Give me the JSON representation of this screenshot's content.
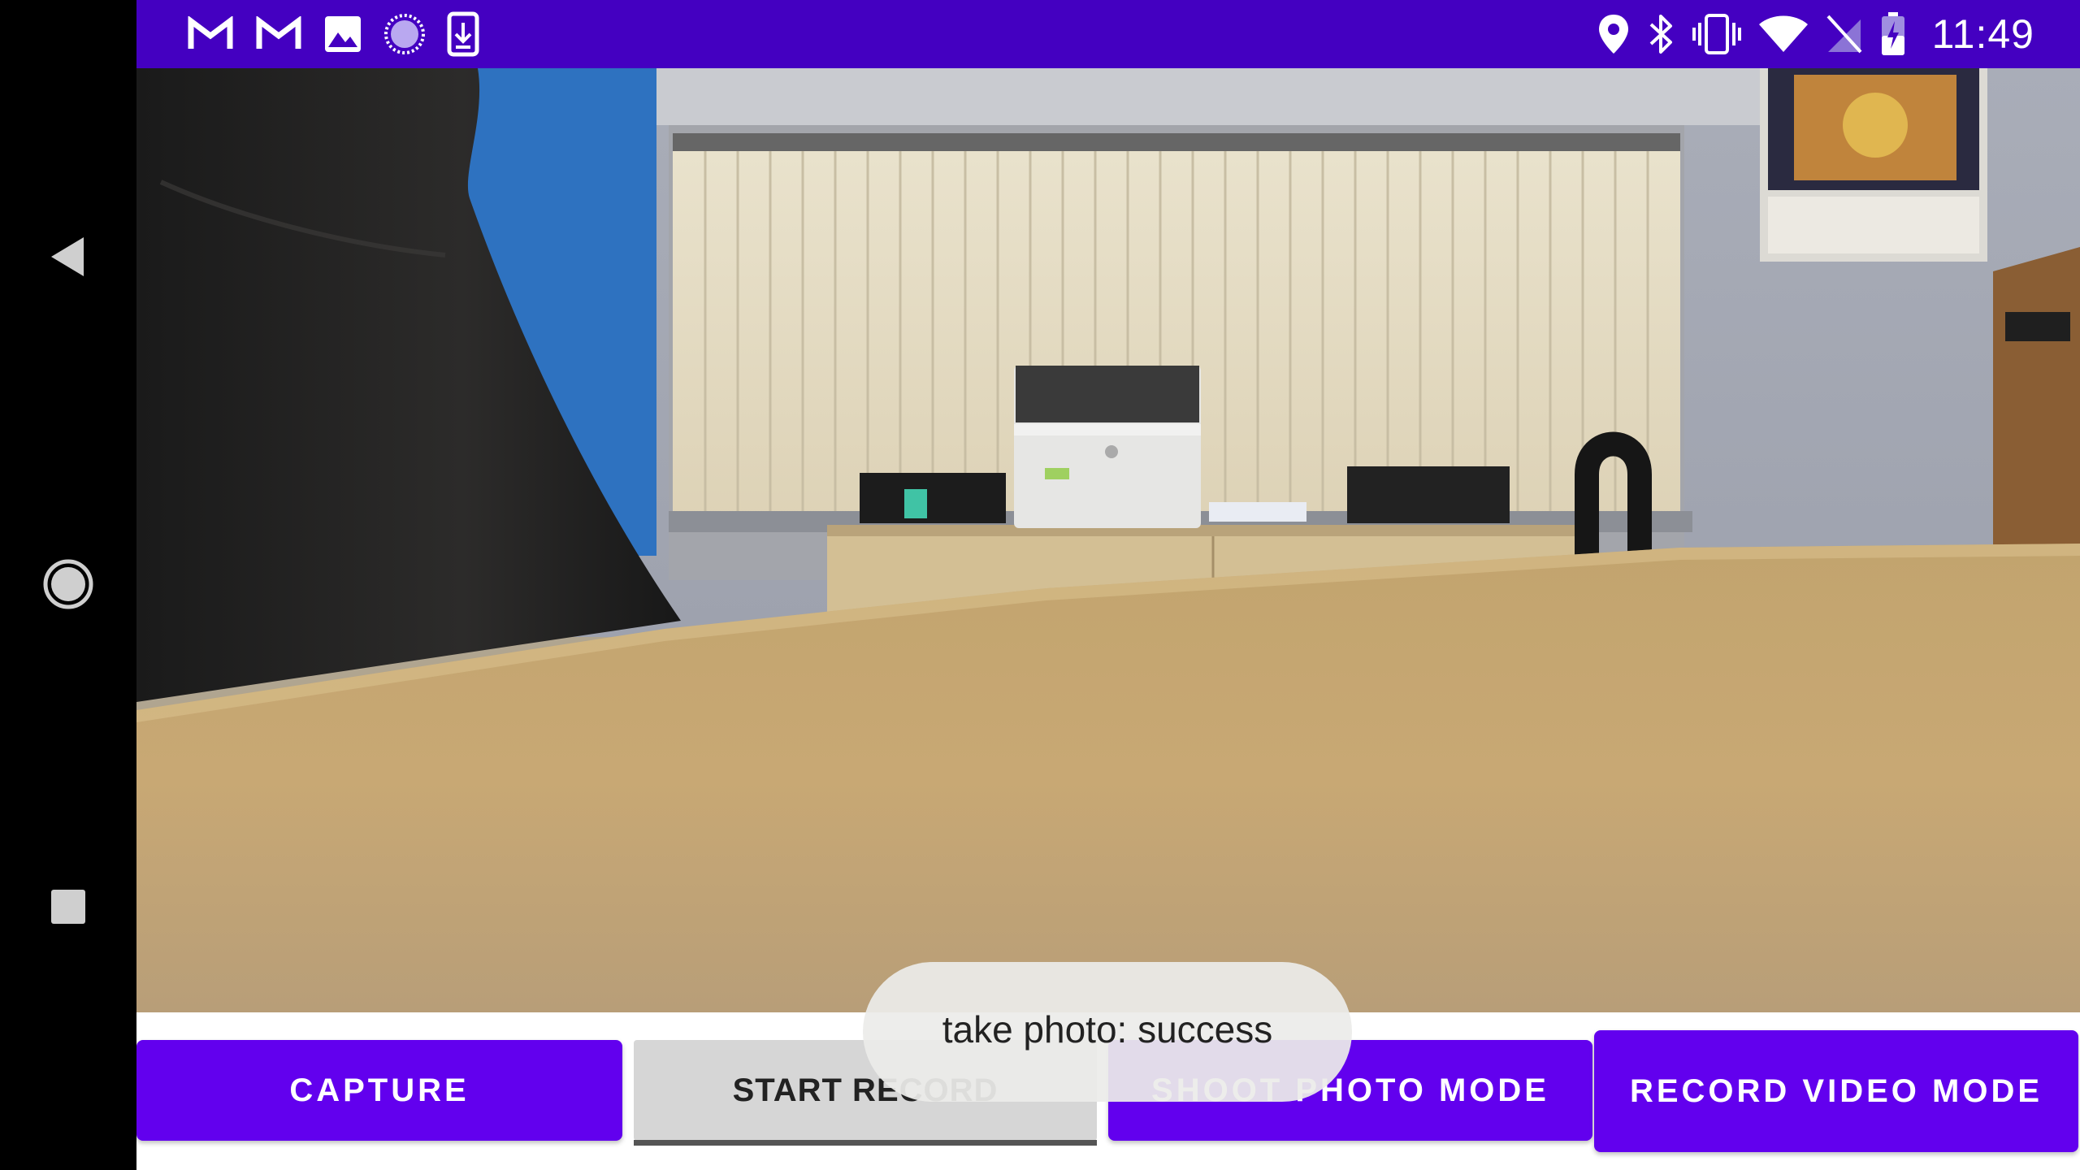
{
  "status_bar": {
    "time": "11:49",
    "notification_icons": [
      "gmail-icon",
      "gmail-icon",
      "image-icon",
      "sync-spinner-icon",
      "download-icon"
    ],
    "system_icons": [
      "location-icon",
      "bluetooth-icon",
      "vibrate-icon",
      "wifi-icon",
      "no-sim-icon",
      "battery-charging-icon"
    ],
    "color": "#4400c1"
  },
  "navigation": {
    "back": "back-icon",
    "home": "home-icon",
    "recents": "recents-icon"
  },
  "controls": {
    "capture_label": "CAPTURE",
    "start_record_label": "START RECORD",
    "shoot_photo_mode_label": "SHOOT PHOTO MODE",
    "record_video_mode_label": "RECORD VIDEO MODE",
    "accent_color": "#6200ee"
  },
  "toast": {
    "message": "take photo: success"
  }
}
